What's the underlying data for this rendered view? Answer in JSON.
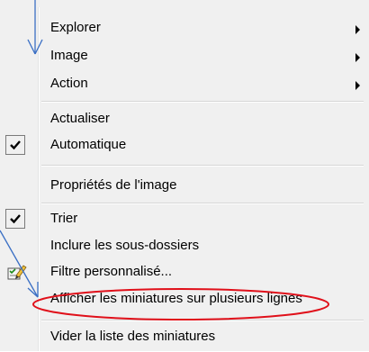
{
  "menu": {
    "items": [
      {
        "label": "Explorer",
        "submenu": true
      },
      {
        "label": "Image",
        "submenu": true
      },
      {
        "label": "Action",
        "submenu": true
      },
      {
        "label": "Actualiser"
      },
      {
        "label": "Automatique",
        "checked": true
      },
      {
        "label": "Propriétés de l'image"
      },
      {
        "label": "Trier",
        "checked": true
      },
      {
        "label": "Inclure les sous-dossiers"
      },
      {
        "label": "Filtre personnalisé...",
        "icon": "filter-edit-icon"
      },
      {
        "label": "Afficher les miniatures sur plusieurs lignes",
        "highlighted": true
      },
      {
        "label": "Vider la liste des miniatures"
      }
    ]
  },
  "colors": {
    "menu_background": "#f0f0f0",
    "annotation_arrow": "#3a6fc4",
    "highlight_ellipse": "#e0101a"
  }
}
